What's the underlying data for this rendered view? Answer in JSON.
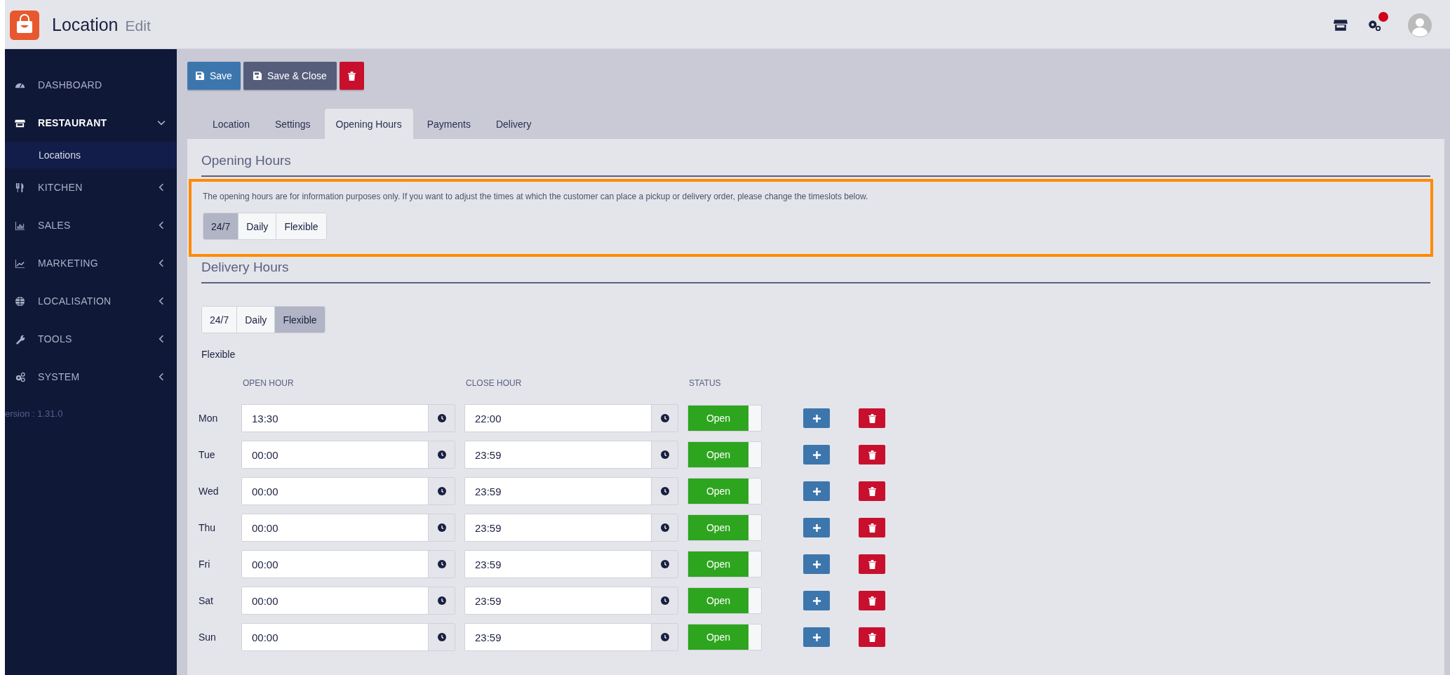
{
  "header": {
    "title": "Location",
    "subtitle": "Edit",
    "notification": true
  },
  "sidebar": {
    "items": [
      {
        "label": "DASHBOARD",
        "expanded": false,
        "has_children": false
      },
      {
        "label": "RESTAURANT",
        "expanded": true,
        "has_children": true,
        "children": [
          {
            "label": "Locations",
            "selected": true
          }
        ]
      },
      {
        "label": "KITCHEN",
        "expanded": false,
        "has_children": true
      },
      {
        "label": "SALES",
        "expanded": false,
        "has_children": true
      },
      {
        "label": "MARKETING",
        "expanded": false,
        "has_children": true
      },
      {
        "label": "LOCALISATION",
        "expanded": false,
        "has_children": true
      },
      {
        "label": "TOOLS",
        "expanded": false,
        "has_children": true
      },
      {
        "label": "SYSTEM",
        "expanded": false,
        "has_children": true
      }
    ],
    "version": "ersion : 1.31.0"
  },
  "toolbar": [
    {
      "kind": "save",
      "label": "Save"
    },
    {
      "kind": "save-close",
      "label": "Save & Close"
    },
    {
      "kind": "delete"
    }
  ],
  "tabs": [
    {
      "label": "Location",
      "selected": false
    },
    {
      "label": "Settings",
      "selected": false
    },
    {
      "label": "Opening Hours",
      "selected": true
    },
    {
      "label": "Payments",
      "selected": false
    },
    {
      "label": "Delivery",
      "selected": false
    }
  ],
  "opening_hours": {
    "title": "Opening Hours",
    "highlighted": true,
    "description": "The opening hours are for information purposes only. If you want to adjust the times at which the customer can place a pickup or delivery order, please change the timeslots below.",
    "modes": [
      {
        "label": "24/7",
        "selected": true
      },
      {
        "label": "Daily",
        "selected": false
      },
      {
        "label": "Flexible",
        "selected": false
      }
    ]
  },
  "delivery_hours": {
    "title": "Delivery Hours",
    "modes": [
      {
        "label": "24/7",
        "selected": false
      },
      {
        "label": "Daily",
        "selected": false
      },
      {
        "label": "Flexible",
        "selected": true
      }
    ],
    "mode_title": "Flexible",
    "columns": [
      "OPEN HOUR",
      "CLOSE HOUR",
      "STATUS"
    ],
    "rows": [
      {
        "day": "Mon",
        "open": "13:30",
        "close": "22:00",
        "status": "Open",
        "on": true
      },
      {
        "day": "Tue",
        "open": "00:00",
        "close": "23:59",
        "status": "Open",
        "on": true
      },
      {
        "day": "Wed",
        "open": "00:00",
        "close": "23:59",
        "status": "Open",
        "on": true
      },
      {
        "day": "Thu",
        "open": "00:00",
        "close": "23:59",
        "status": "Open",
        "on": true
      },
      {
        "day": "Fri",
        "open": "00:00",
        "close": "23:59",
        "status": "Open",
        "on": true
      },
      {
        "day": "Sat",
        "open": "00:00",
        "close": "23:59",
        "status": "Open",
        "on": true
      },
      {
        "day": "Sun",
        "open": "00:00",
        "close": "23:59",
        "status": "Open",
        "on": true
      }
    ]
  }
}
